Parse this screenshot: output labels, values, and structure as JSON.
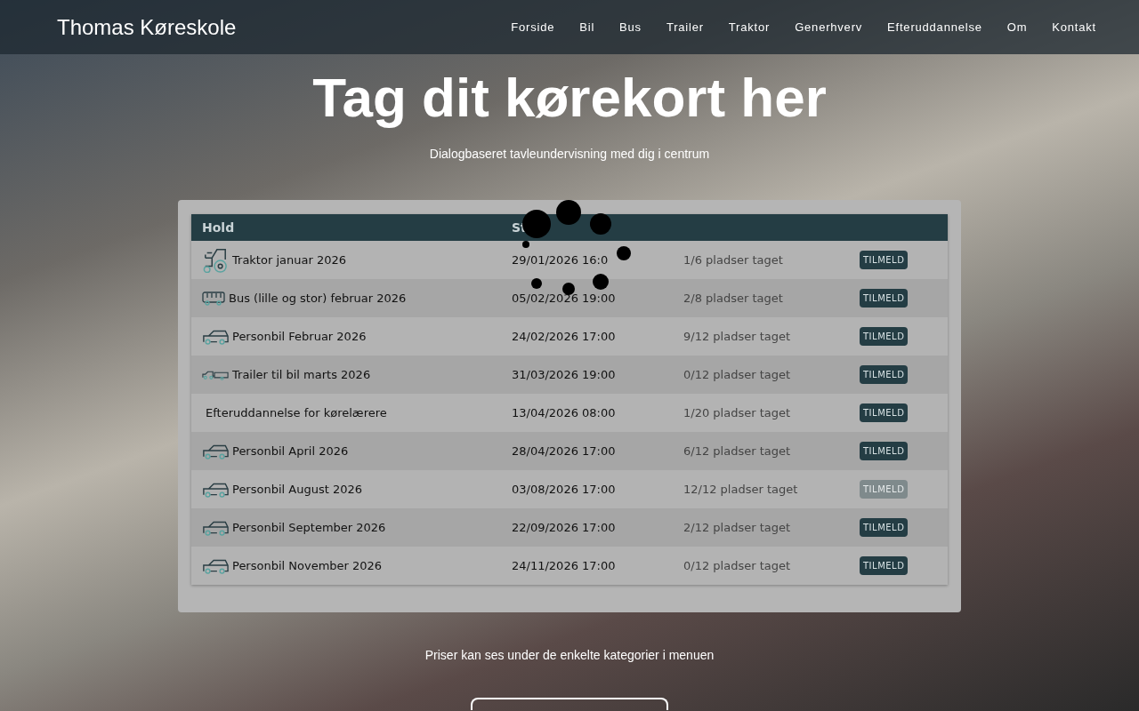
{
  "navbar": {
    "brand": "Thomas Køreskole",
    "links": [
      {
        "label": "Forside"
      },
      {
        "label": "Bil"
      },
      {
        "label": "Bus"
      },
      {
        "label": "Trailer"
      },
      {
        "label": "Traktor"
      },
      {
        "label": "Generhverv"
      },
      {
        "label": "Efteruddannelse"
      },
      {
        "label": "Om"
      },
      {
        "label": "Kontakt"
      }
    ]
  },
  "hero": {
    "title": "Tag dit kørekort her",
    "subtitle": "Dialogbaseret tavleundervisning med dig i centrum"
  },
  "table": {
    "columns": [
      "Hold",
      "St"
    ],
    "loading": true,
    "rows": [
      {
        "kind": "tractor",
        "name": "Traktor januar 2026",
        "start": "29/01/2026 16:0",
        "places": "1/6 pladser taget",
        "button": "TILMELD",
        "disabled": false
      },
      {
        "kind": "bus",
        "name": "Bus (lille og stor) februar 2026",
        "start": "05/02/2026 19:00",
        "places": "2/8 pladser taget",
        "button": "TILMELD",
        "disabled": false
      },
      {
        "kind": "car",
        "name": "Personbil Februar 2026",
        "start": "24/02/2026 17:00",
        "places": "9/12 pladser taget",
        "button": "TILMELD",
        "disabled": false
      },
      {
        "kind": "trailer",
        "name": "Trailer til bil marts 2026",
        "start": "31/03/2026 19:00",
        "places": "0/12 pladser taget",
        "button": "TILMELD",
        "disabled": false
      },
      {
        "kind": "plain",
        "name": "Efteruddannelse for kørelærere",
        "start": "13/04/2026 08:00",
        "places": "1/20 pladser taget",
        "button": "TILMELD",
        "disabled": false
      },
      {
        "kind": "car",
        "name": "Personbil April 2026",
        "start": "28/04/2026 17:00",
        "places": "6/12 pladser taget",
        "button": "TILMELD",
        "disabled": false
      },
      {
        "kind": "car",
        "name": "Personbil August 2026",
        "start": "03/08/2026 17:00",
        "places": "12/12 pladser taget",
        "button": "TILMELD",
        "disabled": true
      },
      {
        "kind": "car",
        "name": "Personbil September 2026",
        "start": "22/09/2026 17:00",
        "places": "2/12 pladser taget",
        "button": "TILMELD",
        "disabled": false
      },
      {
        "kind": "car",
        "name": "Personbil November 2026",
        "start": "24/11/2026 17:00",
        "places": "0/12 pladser taget",
        "button": "TILMELD",
        "disabled": false
      }
    ]
  },
  "note": "Priser kan ses under de enkelte kategorier i menuen"
}
